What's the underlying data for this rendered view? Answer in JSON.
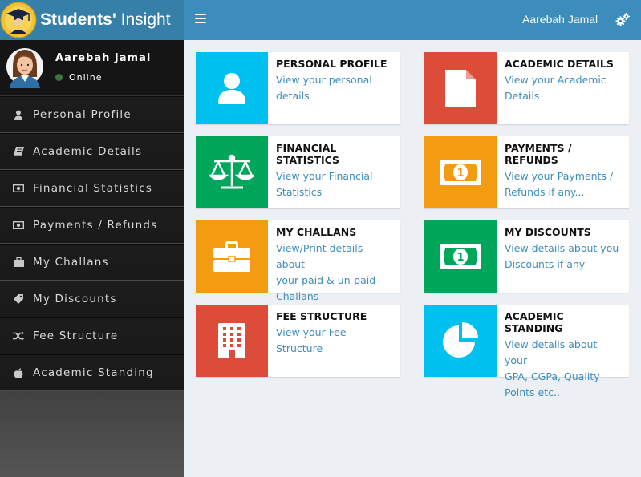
{
  "app": {
    "brand_bold": "Students'",
    "brand_light": " Insight"
  },
  "header": {
    "user_name": "Aarebah Jamal"
  },
  "sidebar": {
    "user": {
      "name": "Aarebah Jamal",
      "status": "Online"
    },
    "items": [
      {
        "label": "Personal Profile",
        "icon": "user-icon"
      },
      {
        "label": "Academic Details",
        "icon": "book-icon"
      },
      {
        "label": "Financial Statistics",
        "icon": "money-icon"
      },
      {
        "label": "Payments / Refunds",
        "icon": "money-icon"
      },
      {
        "label": "My Challans",
        "icon": "briefcase-icon"
      },
      {
        "label": "My Discounts",
        "icon": "tag-icon"
      },
      {
        "label": "Fee Structure",
        "icon": "random-icon"
      },
      {
        "label": "Academic Standing",
        "icon": "apple-icon"
      }
    ]
  },
  "cards": [
    {
      "title": "PERSONAL PROFILE",
      "desc_lines": [
        "View your personal",
        "details"
      ],
      "color": "#00c0ef",
      "icon": "user-icon"
    },
    {
      "title": "ACADEMIC DETAILS",
      "desc_lines": [
        "View your Academic",
        "Details"
      ],
      "color": "#dd4b39",
      "icon": "file-icon"
    },
    {
      "title": "FINANCIAL STATISTICS",
      "desc_lines": [
        "View your Financial",
        "Statistics"
      ],
      "color": "#00a65a",
      "icon": "balance-scale-icon"
    },
    {
      "title": "PAYMENTS / REFUNDS",
      "desc_lines": [
        "View your Payments /",
        "Refunds if any..."
      ],
      "color": "#f39c12",
      "icon": "money-bill-icon"
    },
    {
      "title": "MY CHALLANS",
      "desc_lines": [
        "View/Print details about",
        "your paid & un-paid",
        "Challans"
      ],
      "color": "#f39c12",
      "icon": "briefcase-icon"
    },
    {
      "title": "MY DISCOUNTS",
      "desc_lines": [
        "View details about you",
        "Discounts if any"
      ],
      "color": "#00a65a",
      "icon": "money-bill-icon"
    },
    {
      "title": "FEE STRUCTURE",
      "desc_lines": [
        "View your Fee Structure"
      ],
      "color": "#dd4b39",
      "icon": "building-icon"
    },
    {
      "title": "ACADEMIC STANDING",
      "desc_lines": [
        "View details about your",
        "GPA, CGPa, Quality",
        "Points etc.."
      ],
      "color": "#00c0ef",
      "icon": "pie-chart-icon"
    }
  ]
}
